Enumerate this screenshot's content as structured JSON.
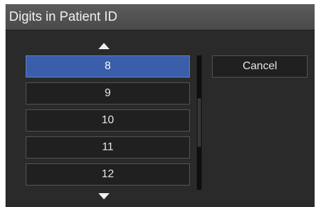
{
  "dialog": {
    "title": "Digits in Patient ID"
  },
  "picker": {
    "items": [
      "8",
      "9",
      "10",
      "11",
      "12"
    ],
    "selected": "8",
    "scroll_up_icon": "triangle-up-icon",
    "scroll_down_icon": "triangle-down-icon"
  },
  "actions": {
    "cancel_label": "Cancel"
  },
  "colors": {
    "background": "#2a2a2a",
    "titlebar": "#4e4e4e",
    "selected": "#3a5eaa",
    "item_background": "#202020",
    "item_border": "#555555",
    "text": "#e6e6e6"
  }
}
